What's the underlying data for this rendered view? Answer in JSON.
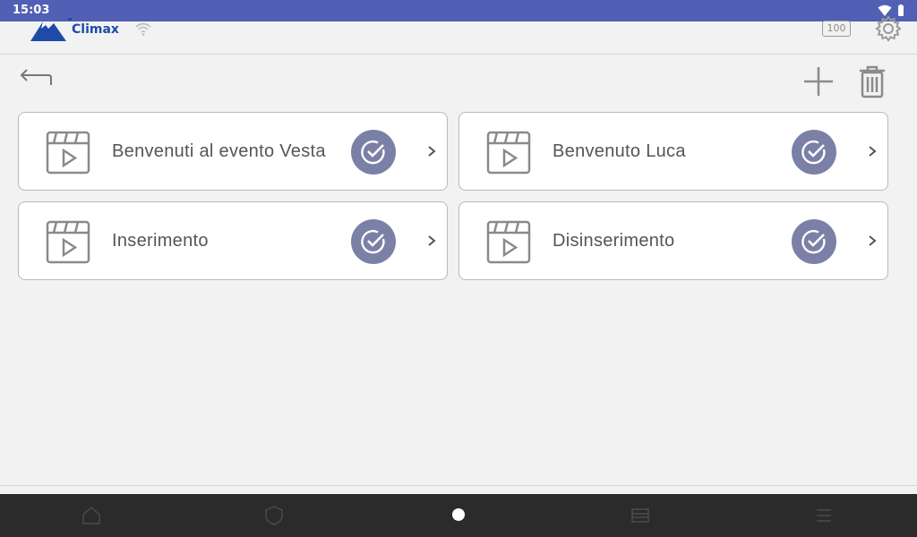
{
  "status_bar": {
    "time": "15:03"
  },
  "header": {
    "logo_text": "Climax",
    "battery_label": "100"
  },
  "items": [
    {
      "label": "Benvenuti al evento Vesta"
    },
    {
      "label": "Benvenuto Luca"
    },
    {
      "label": "Inserimento"
    },
    {
      "label": "Disinserimento"
    }
  ],
  "colors": {
    "status_bar": "#5160b4",
    "check_badge": "#7b80a6",
    "logo": "#1f4aa8"
  }
}
